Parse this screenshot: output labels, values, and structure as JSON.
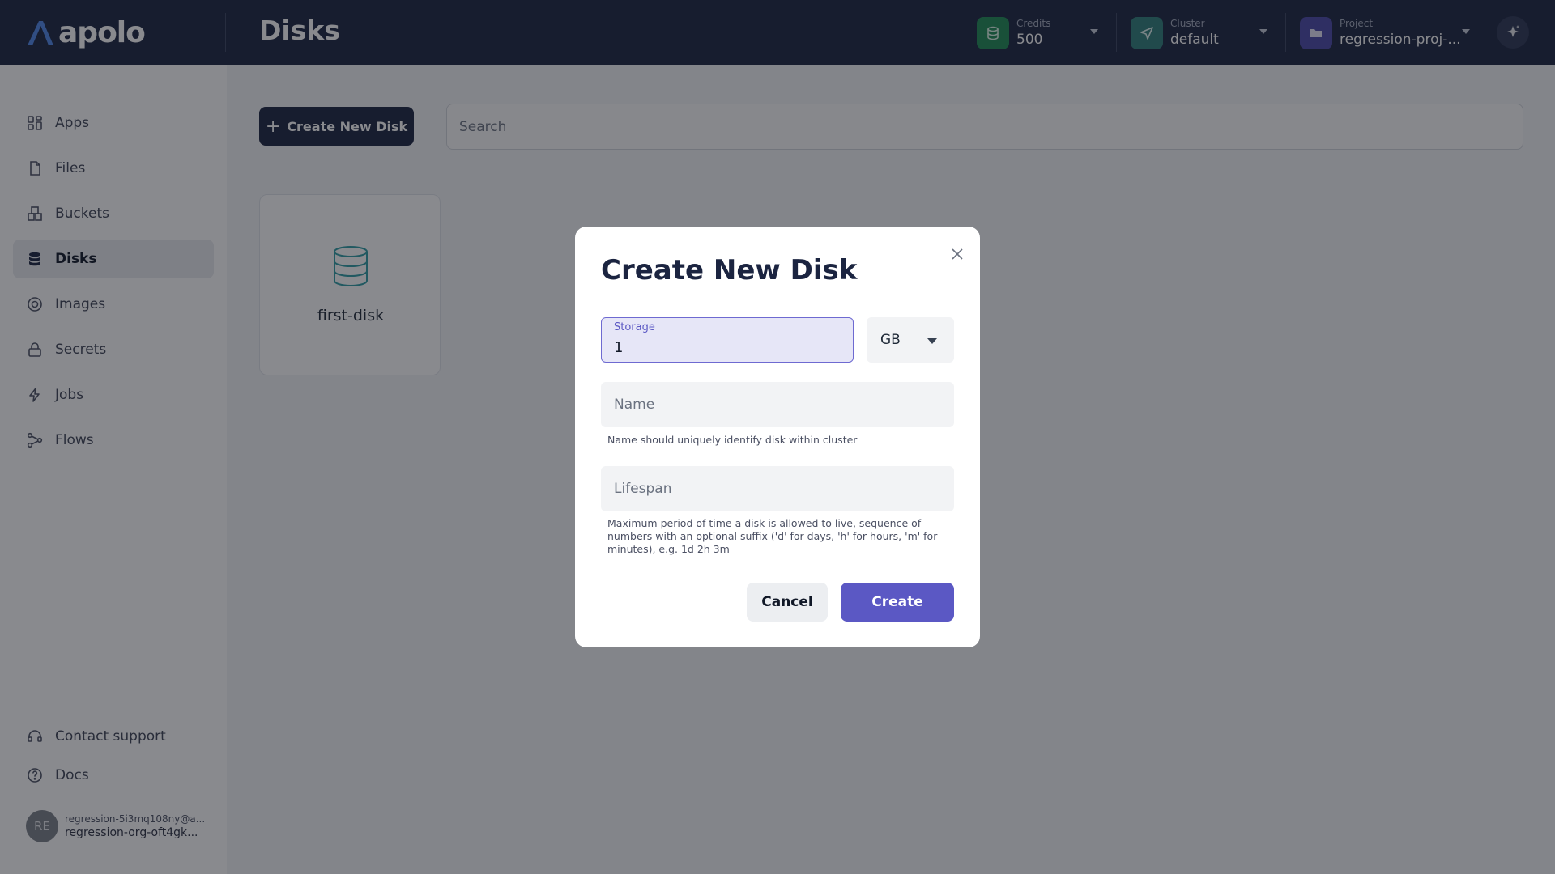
{
  "app": {
    "logo_text": "apolo"
  },
  "header": {
    "title": "Disks",
    "credits": {
      "label": "Credits",
      "value": "500",
      "icon": "coins-icon",
      "color": "#1f8a55"
    },
    "cluster": {
      "label": "Cluster",
      "value": "default",
      "icon": "send-icon",
      "color": "#2f7f7a"
    },
    "project": {
      "label": "Project",
      "value": "regression-proj-...",
      "icon": "folder-icon",
      "color": "#4b48a8"
    },
    "assistant_icon": "sparkle-icon"
  },
  "sidebar": {
    "items": [
      {
        "label": "Apps",
        "icon": "apps-grid-icon",
        "active": false
      },
      {
        "label": "Files",
        "icon": "file-icon",
        "active": false
      },
      {
        "label": "Buckets",
        "icon": "bucket-icon",
        "active": false
      },
      {
        "label": "Disks",
        "icon": "database-icon",
        "active": true
      },
      {
        "label": "Images",
        "icon": "image-icon",
        "active": false
      },
      {
        "label": "Secrets",
        "icon": "lock-icon",
        "active": false
      },
      {
        "label": "Jobs",
        "icon": "lightning-icon",
        "active": false
      },
      {
        "label": "Flows",
        "icon": "flow-icon",
        "active": false
      }
    ],
    "footer": [
      {
        "label": "Contact support",
        "icon": "headset-icon"
      },
      {
        "label": "Docs",
        "icon": "help-circle-icon"
      }
    ],
    "user": {
      "initials": "RE",
      "email": "regression-5i3mq108ny@a...",
      "org": "regression-org-oft4gk..."
    }
  },
  "main": {
    "create_button": "Create New Disk",
    "search_placeholder": "Search",
    "disks": [
      {
        "name": "first-disk",
        "icon": "database-icon"
      }
    ]
  },
  "modal": {
    "title": "Create New Disk",
    "storage": {
      "label": "Storage",
      "value": "1"
    },
    "unit": {
      "selected": "GB"
    },
    "name": {
      "placeholder": "Name",
      "value": "",
      "helper": "Name should uniquely identify disk within cluster"
    },
    "lifespan": {
      "placeholder": "Lifespan",
      "value": "",
      "helper": "Maximum period of time a disk is allowed to live, sequence of numbers with an optional suffix ('d' for days, 'h' for hours, 'm' for minutes), e.g. 1d 2h 3m"
    },
    "cancel_label": "Cancel",
    "create_label": "Create",
    "accent_color": "#5b58c4"
  }
}
